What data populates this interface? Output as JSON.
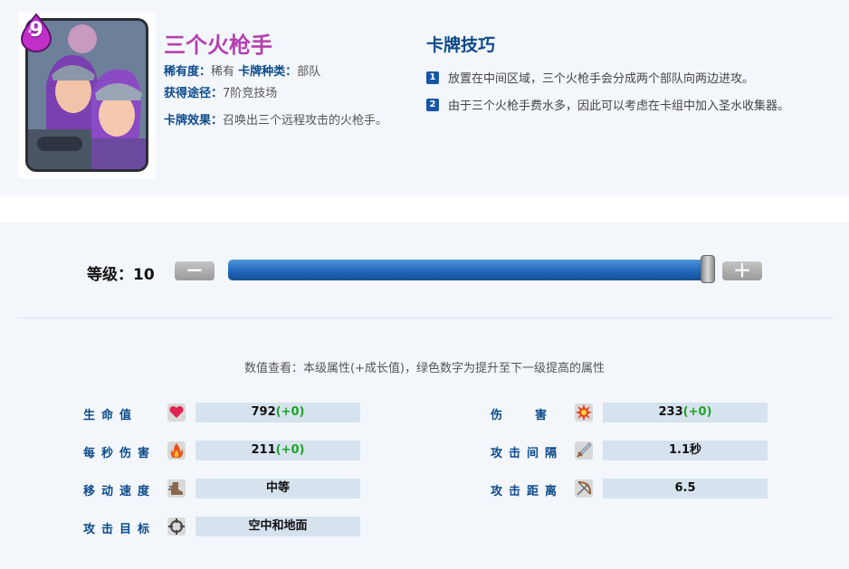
{
  "card": {
    "elixir": "9",
    "name": "三个火枪手",
    "rarity_key": "稀有度：",
    "rarity": "稀有",
    "type_key": "卡牌种类：",
    "type": "部队",
    "source_key": "获得途径：",
    "source": "7阶竞技场",
    "effect_key": "卡牌效果：",
    "effect": "召唤出三个远程攻击的火枪手。"
  },
  "tips": {
    "title": "卡牌技巧",
    "items": [
      {
        "num": "1",
        "text": "放置在中间区域，三个火枪手会分成两个部队向两边进攻。"
      },
      {
        "num": "2",
        "text": "由于三个火枪手费水多，因此可以考虑在卡组中加入圣水收集器。"
      }
    ]
  },
  "level": {
    "label": "等级：10",
    "value": 10,
    "minus": "－",
    "plus": "＋"
  },
  "note": "数值查看：本级属性(+成长值)，绿色数字为提升至下一级提高的属性",
  "stats": {
    "hp": {
      "label": "生命值",
      "value": "792",
      "growth": "(+0)"
    },
    "damage": {
      "label": "伤害",
      "value": "233",
      "growth": "(+0)"
    },
    "dps": {
      "label": "每秒伤害",
      "value": "211",
      "growth": "(+0)"
    },
    "hit_speed": {
      "label": "攻击间隔",
      "value": "1.1秒"
    },
    "move_speed": {
      "label": "移动速度",
      "value": "中等"
    },
    "range": {
      "label": "攻击距离",
      "value": "6.5"
    },
    "targets": {
      "label": "攻击目标",
      "value": "空中和地面"
    }
  },
  "colors": {
    "name": "#b53fb0",
    "key": "#0d4a8a",
    "growth": "#1fa326",
    "slider": "#1f64b8"
  }
}
